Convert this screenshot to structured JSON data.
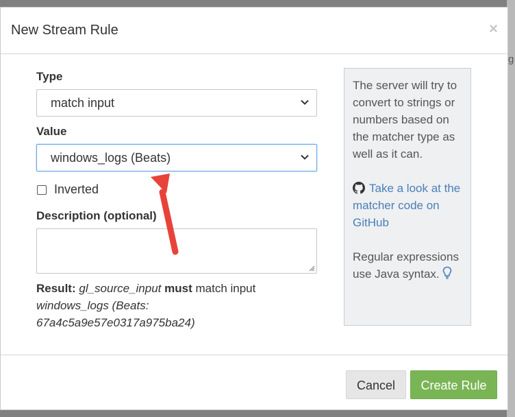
{
  "modal": {
    "title": "New Stream Rule",
    "close_symbol": "×"
  },
  "form": {
    "type_label": "Type",
    "type_value": "match input",
    "value_label": "Value",
    "value_value": "windows_logs (Beats)",
    "inverted_label": "Inverted",
    "inverted_checked": false,
    "description_label": "Description (optional)",
    "description_value": ""
  },
  "result": {
    "prefix": "Result:",
    "field": "gl_source_input",
    "must": "must",
    "match_text": "match input",
    "target_name": "windows_logs (Beats:",
    "target_id": "67a4c5a9e57e0317a975ba24)"
  },
  "help": {
    "text1": "The server will try to convert to strings or numbers based on the matcher type as well as it can.",
    "github_icon": "github-icon",
    "link_text": "Take a look at the matcher code on GitHub",
    "text2": "Regular expressions use Java syntax.",
    "bulb_icon": "lightbulb-icon"
  },
  "footer": {
    "cancel_label": "Cancel",
    "create_label": "Create Rule"
  },
  "colors": {
    "accent_green": "#7ab555",
    "link_blue": "#4b7fb8",
    "annotation_red": "#e8433a"
  }
}
